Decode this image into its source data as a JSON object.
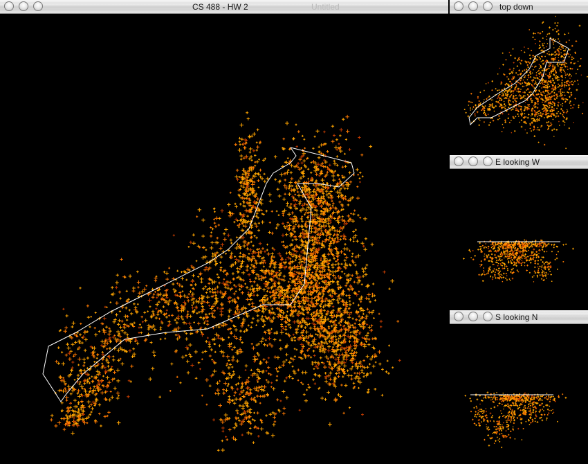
{
  "main_window": {
    "title": "CS 488 - HW 2",
    "subtitle": "Untitled"
  },
  "views": [
    {
      "key": "top_down",
      "title": "top down"
    },
    {
      "key": "e_looking_w",
      "title": "E looking W"
    },
    {
      "key": "s_looking_n",
      "title": "S looking N"
    }
  ],
  "colors": {
    "background": "#000000",
    "point_primary": "#ffa500",
    "point_secondary": "#ff7a00",
    "point_dark": "#c43c00",
    "outline": "#ffffff",
    "titlebar": "#e4e4e4"
  },
  "icons": {
    "close": "close-button-icon",
    "minimize": "minimize-button-icon",
    "zoom": "zoom-button-icon"
  }
}
